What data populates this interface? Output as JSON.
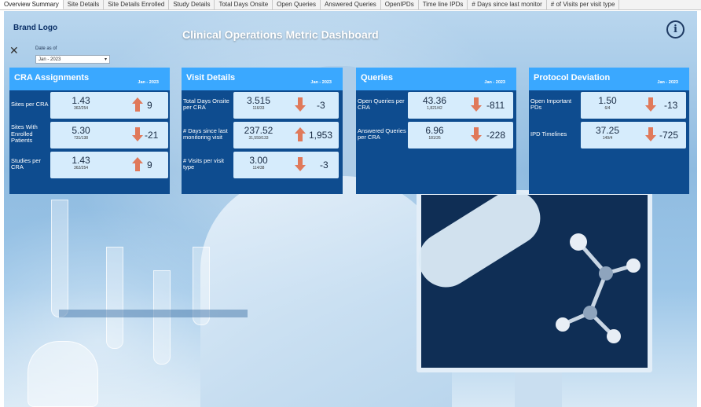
{
  "tabs": [
    {
      "label": "Overview Summary",
      "active": true
    },
    {
      "label": "Site Details"
    },
    {
      "label": "Site Details Enrolled"
    },
    {
      "label": "Study Details"
    },
    {
      "label": "Total Days Onsite"
    },
    {
      "label": "Open Queries"
    },
    {
      "label": "Answered Queries"
    },
    {
      "label": "OpenIPDs"
    },
    {
      "label": "Time line IPDs"
    },
    {
      "label": "# Days since last monitor"
    },
    {
      "label": "# of Visits per visit type"
    }
  ],
  "header": {
    "brand": "Brand Logo",
    "title": "Clinical Operations Metric Dashboard",
    "info_icon": "info-icon",
    "close_icon": "close-icon"
  },
  "filter": {
    "label": "Date as of",
    "value": "Jan - 2023"
  },
  "colors": {
    "card_header": "#3aa8ff",
    "card_body": "#0e4c8f",
    "up_arrow": "#e0795a",
    "down_arrow": "#e0795a"
  },
  "cards": [
    {
      "title": "CRA Assignments",
      "date": "Jan - 2023",
      "rows": [
        {
          "label": "Sites per CRA",
          "value": "1.43",
          "sub": "362/254",
          "direction": "up",
          "delta": "9"
        },
        {
          "label": "Sites With Enrolled Patients",
          "value": "5.30",
          "sub": "731/138",
          "direction": "down",
          "delta": "-21"
        },
        {
          "label": "Studies per CRA",
          "value": "1.43",
          "sub": "362/254",
          "direction": "up",
          "delta": "9"
        }
      ]
    },
    {
      "title": "Visit Details",
      "date": "Jan - 2023",
      "rows": [
        {
          "label": "Total Days Onsite per CRA",
          "value": "3.515",
          "sub": "116/33",
          "direction": "down",
          "delta": "-3"
        },
        {
          "label": "# Days since last monitoring visit",
          "value": "237.52",
          "sub": "31,559/133",
          "direction": "up",
          "delta": "1,953"
        },
        {
          "label": "# Visits per visit type",
          "value": "3.00",
          "sub": "114/38",
          "direction": "down",
          "delta": "-3"
        }
      ]
    },
    {
      "title": "Queries",
      "date": "Jan - 2023",
      "rows": [
        {
          "label": "Open Queries per CRA",
          "value": "43.36",
          "sub": "1,821/42",
          "direction": "down",
          "delta": "-811"
        },
        {
          "label": "Answered Queries per CRA",
          "value": "6.96",
          "sub": "181/26",
          "direction": "down",
          "delta": "-228"
        }
      ]
    },
    {
      "title": "Protocol Deviation",
      "date": "Jan - 2023",
      "rows": [
        {
          "label": "Open Important PDs",
          "value": "1.50",
          "sub": "6/4",
          "direction": "down",
          "delta": "-13"
        },
        {
          "label": "IPD Timelines",
          "value": "37.25",
          "sub": "149/4",
          "direction": "down",
          "delta": "-725"
        }
      ]
    }
  ]
}
